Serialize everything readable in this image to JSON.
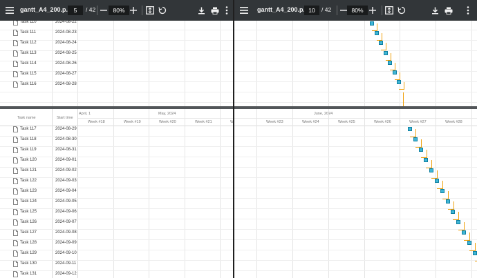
{
  "left": {
    "title": "gantt_A4_200.p...",
    "page": "5",
    "total": "/ 42",
    "zoom": "80%",
    "rows_top": [
      {
        "name": "Task 110",
        "date": "2024-08-22"
      },
      {
        "name": "Task 111",
        "date": "2024-08-23"
      },
      {
        "name": "Task 112",
        "date": "2024-08-24"
      },
      {
        "name": "Task 113",
        "date": "2024-08-25"
      },
      {
        "name": "Task 114",
        "date": "2024-08-26"
      },
      {
        "name": "Task 115",
        "date": "2024-08-27"
      },
      {
        "name": "Task 116",
        "date": "2024-08-28"
      }
    ],
    "header": {
      "task_name": "Task name",
      "start_time": "Start time",
      "months": [
        "April, 1",
        "May, 2024"
      ],
      "weeks": [
        "Week #18",
        "Week #19",
        "Week #20",
        "Week #21",
        "Week #22"
      ]
    },
    "rows_bottom": [
      {
        "name": "Task 117",
        "date": "2024-08-29"
      },
      {
        "name": "Task 118",
        "date": "2024-08-30"
      },
      {
        "name": "Task 119",
        "date": "2024-08-31"
      },
      {
        "name": "Task 120",
        "date": "2024-09-01"
      },
      {
        "name": "Task 121",
        "date": "2024-09-02"
      },
      {
        "name": "Task 122",
        "date": "2024-09-03"
      },
      {
        "name": "Task 123",
        "date": "2024-09-04"
      },
      {
        "name": "Task 124",
        "date": "2024-09-05"
      },
      {
        "name": "Task 125",
        "date": "2024-09-06"
      },
      {
        "name": "Task 126",
        "date": "2024-09-07"
      },
      {
        "name": "Task 127",
        "date": "2024-09-08"
      },
      {
        "name": "Task 128",
        "date": "2024-09-09"
      },
      {
        "name": "Task 129",
        "date": "2024-09-10"
      },
      {
        "name": "Task 130",
        "date": "2024-09-11"
      },
      {
        "name": "Task 131",
        "date": "2024-09-12"
      }
    ]
  },
  "right": {
    "title": "gantt_A4_200.p...",
    "page": "10",
    "total": "/ 42",
    "zoom": "80%",
    "header": {
      "month": "June, 2024",
      "weeks": [
        "Week #23",
        "Week #24",
        "Week #25",
        "Week #26",
        "Week #27",
        "Week #28"
      ]
    },
    "bar_label": "Tas"
  },
  "icons": {
    "menu": "menu-icon",
    "minus": "zoom-out-icon",
    "plus": "zoom-in-icon",
    "fit": "fit-to-page-icon",
    "rotate": "rotate-icon",
    "download": "download-icon",
    "print": "print-icon",
    "more": "more-vert-icon",
    "doc": "document-icon"
  },
  "colors": {
    "toolbar": "#323639",
    "bar_fill": "#3fb5d6",
    "bar_border": "#0d7fa0",
    "dependency": "#f0a00a"
  }
}
